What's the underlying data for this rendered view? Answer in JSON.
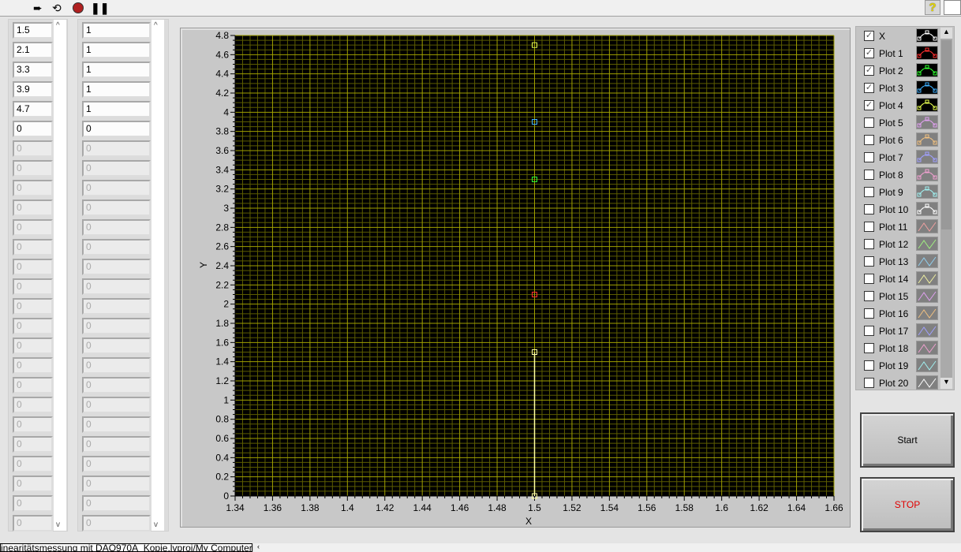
{
  "toolbar": {
    "run_icon": "run-arrow-icon",
    "run_cont_icon": "run-continuously-icon",
    "abort_icon": "abort-icon",
    "pause_icon": "pause-icon",
    "help_label": "?"
  },
  "array_left": {
    "values": [
      "1.5",
      "2.1",
      "3.3",
      "3.9",
      "4.7",
      "0",
      "0",
      "0",
      "0",
      "0",
      "0",
      "0",
      "0",
      "0",
      "0",
      "0",
      "0",
      "0",
      "0",
      "0",
      "0",
      "0",
      "0",
      "0",
      "0",
      "0"
    ],
    "active_count": 6
  },
  "array_right": {
    "values": [
      "1",
      "1",
      "1",
      "1",
      "1",
      "0",
      "0",
      "0",
      "0",
      "0",
      "0",
      "0",
      "0",
      "0",
      "0",
      "0",
      "0",
      "0",
      "0",
      "0",
      "0",
      "0",
      "0",
      "0",
      "0",
      "0"
    ],
    "active_count": 6
  },
  "legend": {
    "items": [
      {
        "label": "X",
        "checked": true,
        "color": "#ffffff",
        "style": "point",
        "active": true
      },
      {
        "label": "Plot 1",
        "checked": true,
        "color": "#ff3030",
        "style": "point",
        "active": true
      },
      {
        "label": "Plot 2",
        "checked": true,
        "color": "#30ff30",
        "style": "point",
        "active": true
      },
      {
        "label": "Plot 3",
        "checked": true,
        "color": "#40b0ff",
        "style": "point",
        "active": true
      },
      {
        "label": "Plot 4",
        "checked": true,
        "color": "#e8ff50",
        "style": "point",
        "active": true
      },
      {
        "label": "Plot 5",
        "checked": false,
        "color": "#e0a0f0",
        "style": "point"
      },
      {
        "label": "Plot 6",
        "checked": false,
        "color": "#f0c080",
        "style": "point"
      },
      {
        "label": "Plot 7",
        "checked": false,
        "color": "#a0a0ff",
        "style": "point"
      },
      {
        "label": "Plot 8",
        "checked": false,
        "color": "#f0a0d0",
        "style": "point"
      },
      {
        "label": "Plot 9",
        "checked": false,
        "color": "#a0f0f0",
        "style": "point"
      },
      {
        "label": "Plot 10",
        "checked": false,
        "color": "#ffffff",
        "style": "point"
      },
      {
        "label": "Plot 11",
        "checked": false,
        "color": "#f0a0a0",
        "style": "line"
      },
      {
        "label": "Plot 12",
        "checked": false,
        "color": "#a0f080",
        "style": "line"
      },
      {
        "label": "Plot 13",
        "checked": false,
        "color": "#90d0f0",
        "style": "line"
      },
      {
        "label": "Plot 14",
        "checked": false,
        "color": "#f0f0a0",
        "style": "line"
      },
      {
        "label": "Plot 15",
        "checked": false,
        "color": "#e0a0f0",
        "style": "line"
      },
      {
        "label": "Plot 16",
        "checked": false,
        "color": "#f0c080",
        "style": "line"
      },
      {
        "label": "Plot 17",
        "checked": false,
        "color": "#a0a0ff",
        "style": "line"
      },
      {
        "label": "Plot 18",
        "checked": false,
        "color": "#f0a0d0",
        "style": "line"
      },
      {
        "label": "Plot 19",
        "checked": false,
        "color": "#a0f0f0",
        "style": "line"
      },
      {
        "label": "Plot 20",
        "checked": false,
        "color": "#ffffff",
        "style": "line"
      }
    ]
  },
  "buttons": {
    "start": "Start",
    "stop": "STOP"
  },
  "status_text": "inearitätsmessung mit DAQ970A_Kopie.lvproj/My Computer",
  "chart_data": {
    "type": "scatter",
    "xlabel": "X",
    "ylabel": "Y",
    "xlim": [
      1.34,
      1.66
    ],
    "ylim": [
      0,
      4.8
    ],
    "xticks": [
      "1.34",
      "1.36",
      "1.38",
      "1.4",
      "1.42",
      "1.44",
      "1.46",
      "1.48",
      "1.5",
      "1.52",
      "1.54",
      "1.56",
      "1.58",
      "1.6",
      "1.62",
      "1.64",
      "1.66"
    ],
    "yticks": [
      "0",
      "0.2",
      "0.4",
      "0.6",
      "0.8",
      "1",
      "1.2",
      "1.4",
      "1.6",
      "1.8",
      "2",
      "2.2",
      "2.4",
      "2.6",
      "2.8",
      "3",
      "3.2",
      "3.4",
      "3.6",
      "3.8",
      "4",
      "4.2",
      "4.4",
      "4.6",
      "4.8"
    ],
    "grid": true,
    "background": "#000000",
    "major_grid_color": "#a0a000",
    "minor_grid_color": "#5c5c00",
    "series": [
      {
        "name": "X",
        "color": "#ffffa0",
        "points": [
          [
            1.5,
            0
          ],
          [
            1.5,
            1.5
          ]
        ],
        "line": true
      },
      {
        "name": "Plot 1",
        "color": "#ff3030",
        "points": [
          [
            1.5,
            2.1
          ]
        ]
      },
      {
        "name": "Plot 2",
        "color": "#30ff30",
        "points": [
          [
            1.5,
            3.3
          ]
        ]
      },
      {
        "name": "Plot 3",
        "color": "#40b0ff",
        "points": [
          [
            1.5,
            3.9
          ]
        ]
      },
      {
        "name": "Plot 4",
        "color": "#e8ff50",
        "points": [
          [
            1.5,
            4.7
          ]
        ]
      }
    ]
  }
}
